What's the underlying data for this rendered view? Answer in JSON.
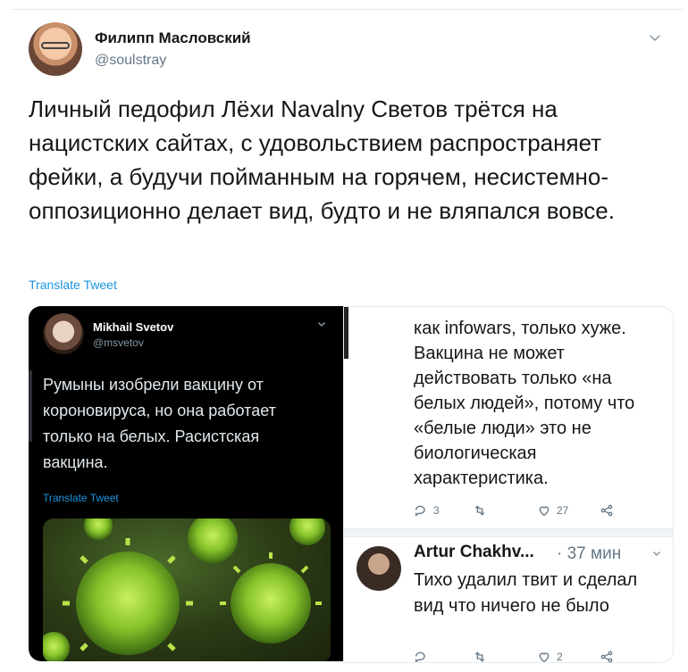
{
  "tweet": {
    "author_name": "Филипп Масловский",
    "author_handle": "@soulstray",
    "text": "Личный педофил Лёхи Navalny Светов трётся на нацистских сайтах, с удовольствием распространяет фейки, а будучи пойманным на горячем, несистемно-оппозиционно делает вид, будто и не вляпался вовсе.",
    "translate_label": "Translate Tweet"
  },
  "embedded_left": {
    "author_name": "Mikhail Svetov",
    "author_handle": "@msvetov",
    "text": "Румыны изобрели вакцину от короновируса, но она работает только на белых. Расистская вакцина.",
    "translate_label": "Translate Tweet"
  },
  "embedded_right": {
    "text": "как infowars, только хуже. Вакцина не может действовать только «на белых людей», потому что «белые люди» это не биологическая характеристика.",
    "actions": {
      "replies": "3",
      "retweets": "",
      "likes": "27"
    },
    "reply": {
      "author_name": "Artur Chakhv...",
      "time": "· 37 мин",
      "text": "Тихо удалил твит и сделал вид что ничего не было",
      "actions": {
        "replies": "",
        "retweets": "",
        "likes": "2"
      }
    }
  },
  "colors": {
    "link": "#1b95e0",
    "muted": "#657786",
    "text": "#14171a",
    "virus": "#9acd32"
  },
  "icons": [
    "chevron-down-icon",
    "reply-icon",
    "retweet-icon",
    "like-icon",
    "share-icon"
  ]
}
